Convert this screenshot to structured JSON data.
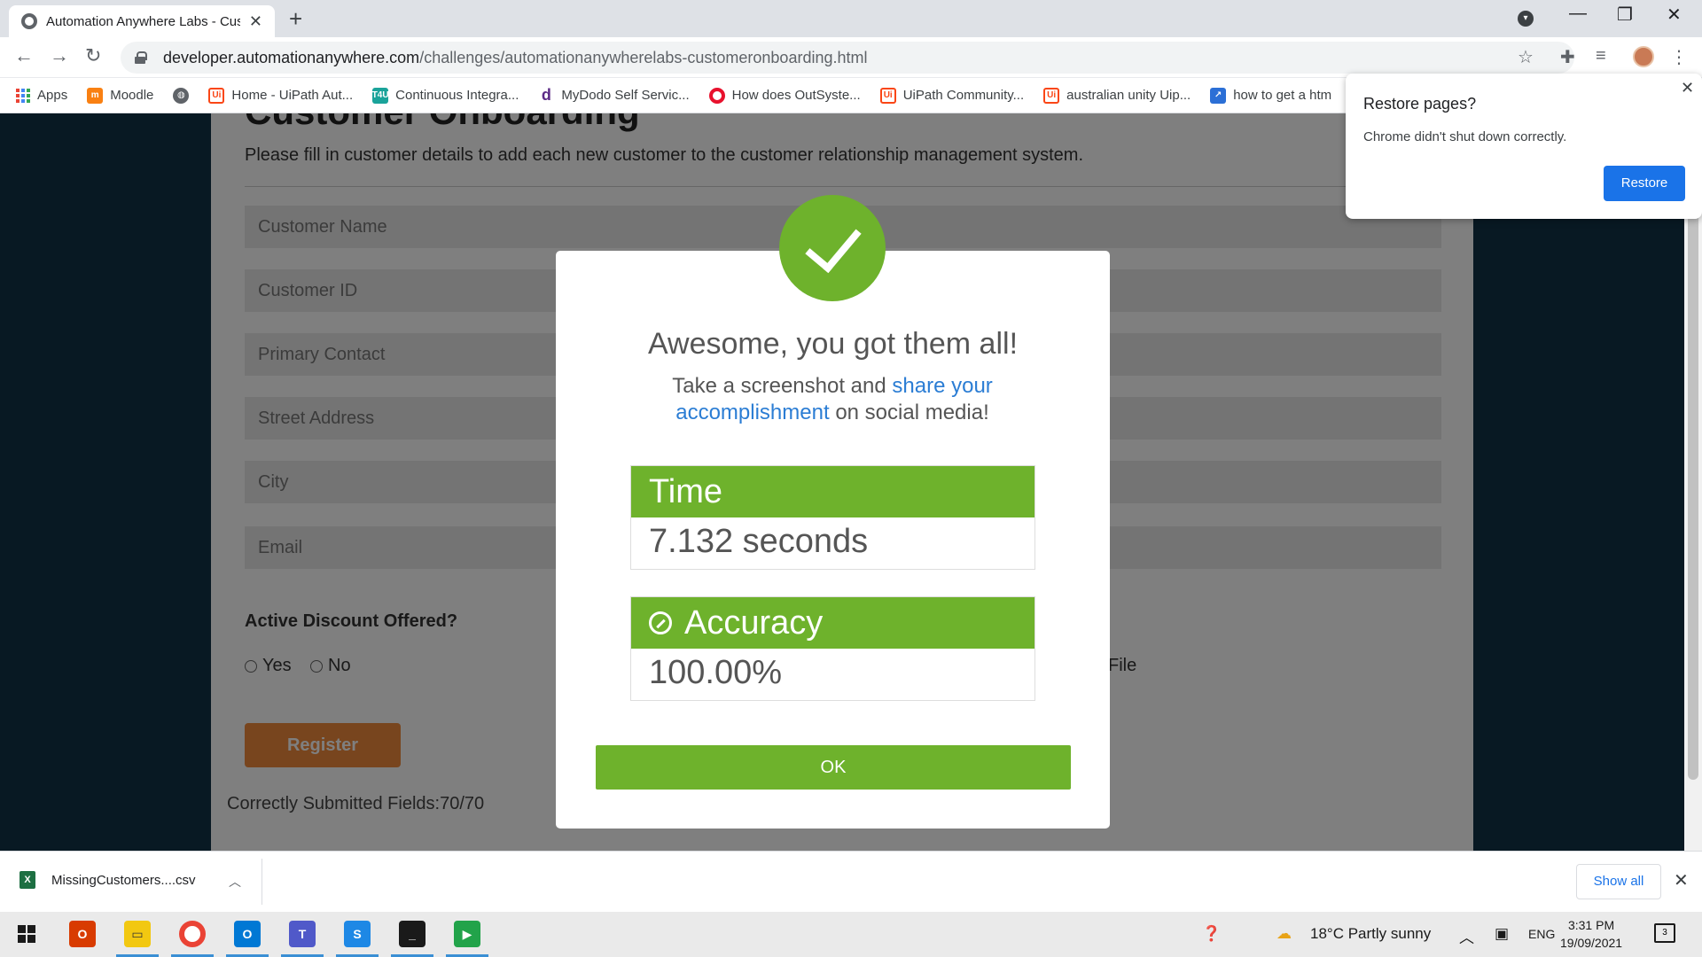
{
  "browser": {
    "tab_title": "Automation Anywhere Labs - Customer Onboarding",
    "url_host": "developer.automationanywhere.com",
    "url_path": "/challenges/automationanywherelabs-customeronboarding.html",
    "bookmarks": [
      {
        "label": "Apps",
        "icon": "apps-grid-icon"
      },
      {
        "label": "Moodle",
        "icon": "moodle-icon"
      },
      {
        "label": "",
        "icon": "globe-icon"
      },
      {
        "label": "Home - UiPath Aut...",
        "icon": "uipath-icon"
      },
      {
        "label": "Continuous Integra...",
        "icon": "t4u-icon"
      },
      {
        "label": "MyDodo Self Servic...",
        "icon": "dodo-icon"
      },
      {
        "label": "How does OutSyste...",
        "icon": "outsystems-icon"
      },
      {
        "label": "UiPath Community...",
        "icon": "uipath-icon"
      },
      {
        "label": "australian unity Uip...",
        "icon": "uipath-icon"
      },
      {
        "label": "how to get a htm",
        "icon": "generic-icon"
      }
    ]
  },
  "page": {
    "heading": "Customer Onboarding",
    "description": "Please fill in customer details to add each new customer to the customer relationship management system.",
    "fields": [
      {
        "placeholder": "Customer Name"
      },
      {
        "placeholder": "Customer ID"
      },
      {
        "placeholder": "Primary Contact"
      },
      {
        "placeholder": "Street Address"
      },
      {
        "placeholder": "City"
      },
      {
        "placeholder": "Email"
      }
    ],
    "discount_label": "Active Discount Offered?",
    "radio_yes": "Yes",
    "radio_no": "No",
    "file_label": "File",
    "register_button": "Register",
    "submitted_text": "Correctly Submitted Fields:70/70"
  },
  "modal": {
    "title": "Awesome, you got them all!",
    "subtitle_pre": "Take a screenshot and",
    "subtitle_link": "share your accomplishment",
    "subtitle_post": "on social media!",
    "time_label": "Time",
    "time_value": "7.132 seconds",
    "accuracy_label": "Accuracy",
    "accuracy_value": "100.00%",
    "ok_button": "OK",
    "accent_color": "#6eb22c"
  },
  "restore_popup": {
    "title": "Restore pages?",
    "message": "Chrome didn't shut down correctly.",
    "button": "Restore"
  },
  "download_shelf": {
    "filename": "MissingCustomers....csv",
    "show_all": "Show all"
  },
  "taskbar": {
    "weather": "18°C  Partly sunny",
    "language": "ENG",
    "time": "3:31 PM",
    "date": "19/09/2021",
    "notification_count": "3"
  }
}
